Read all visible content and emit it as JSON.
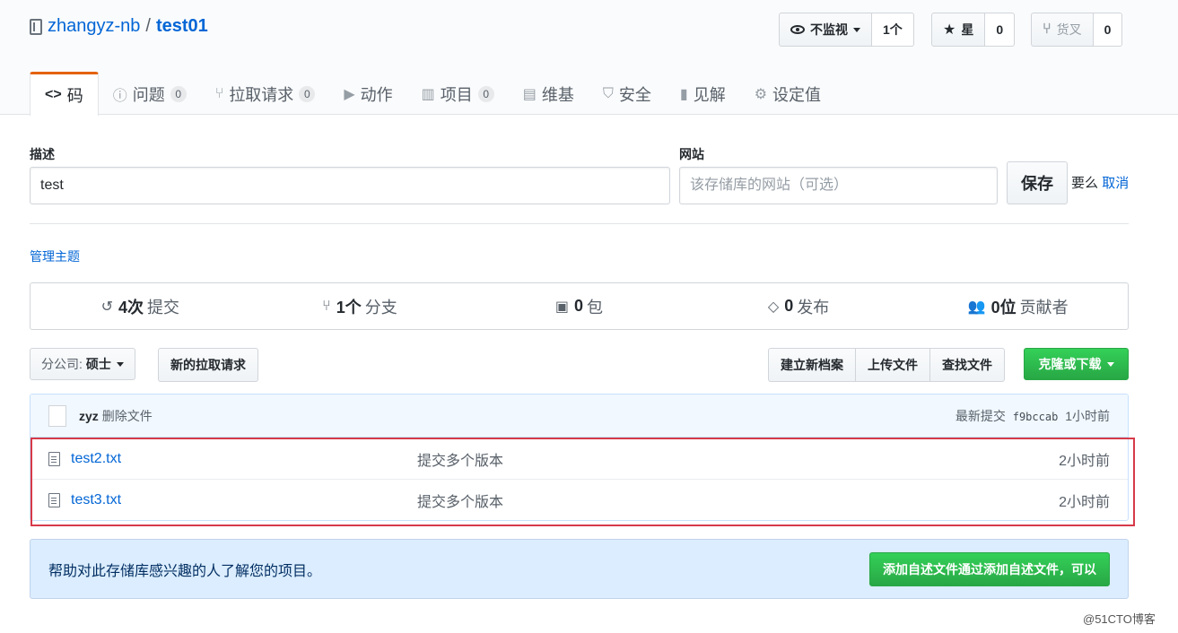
{
  "repo": {
    "owner": "zhangyz-nb",
    "separator": "/",
    "name": "test01"
  },
  "header_buttons": {
    "watch": {
      "label": "不监视",
      "count": "1个"
    },
    "star": {
      "label": "星",
      "count": "0"
    },
    "fork": {
      "label": "货叉",
      "count": "0"
    }
  },
  "tabs": [
    {
      "icon": "<>",
      "label": "码",
      "active": true
    },
    {
      "icon": "ⓘ",
      "label": "问题",
      "count": "0"
    },
    {
      "icon": "⑂",
      "label": "拉取请求",
      "count": "0"
    },
    {
      "icon": "▶",
      "label": "动作"
    },
    {
      "icon": "▥",
      "label": "项目",
      "count": "0"
    },
    {
      "icon": "▤",
      "label": "维基"
    },
    {
      "icon": "⛉",
      "label": "安全"
    },
    {
      "icon": "▮",
      "label": "见解"
    },
    {
      "icon": "⚙",
      "label": "设定值"
    }
  ],
  "form": {
    "description_label": "描述",
    "description_value": "test",
    "website_label": "网站",
    "website_placeholder": "该存储库的网站（可选）",
    "save_label": "保存",
    "or_text": "要么",
    "cancel_label": "取消"
  },
  "manage_topics": "管理主题",
  "summary": [
    {
      "icon": "↺",
      "num": "4次",
      "label": "提交"
    },
    {
      "icon": "⑂",
      "num": "1个",
      "label": "分支"
    },
    {
      "icon": "▣",
      "num": "0",
      "label": "包"
    },
    {
      "icon": "◇",
      "num": "0",
      "label": "发布"
    },
    {
      "icon": "👥",
      "num": "0位",
      "label": "贡献者"
    }
  ],
  "branch": {
    "prefix": "分公司:",
    "value": "硕士"
  },
  "new_pr_label": "新的拉取请求",
  "file_actions": [
    "建立新档案",
    "上传文件",
    "查找文件"
  ],
  "clone_label": "克隆或下载",
  "latest_commit": {
    "author": "zyz",
    "message": "删除文件",
    "prefix": "最新提交",
    "sha": "f9bccab",
    "age": "1小时前"
  },
  "files": [
    {
      "name": "test2.txt",
      "message": "提交多个版本",
      "age": "2小时前"
    },
    {
      "name": "test3.txt",
      "message": "提交多个版本",
      "age": "2小时前"
    }
  ],
  "readme": {
    "text": "帮助对此存储库感兴趣的人了解您的项目。",
    "button": "添加自述文件通过添加自述文件，可以"
  },
  "watermark": "@51CTO博客",
  "colors": {
    "accent": "#0366d6",
    "tab_active": "#e36209",
    "green": "#28a745",
    "highlight": "#d73a49"
  }
}
